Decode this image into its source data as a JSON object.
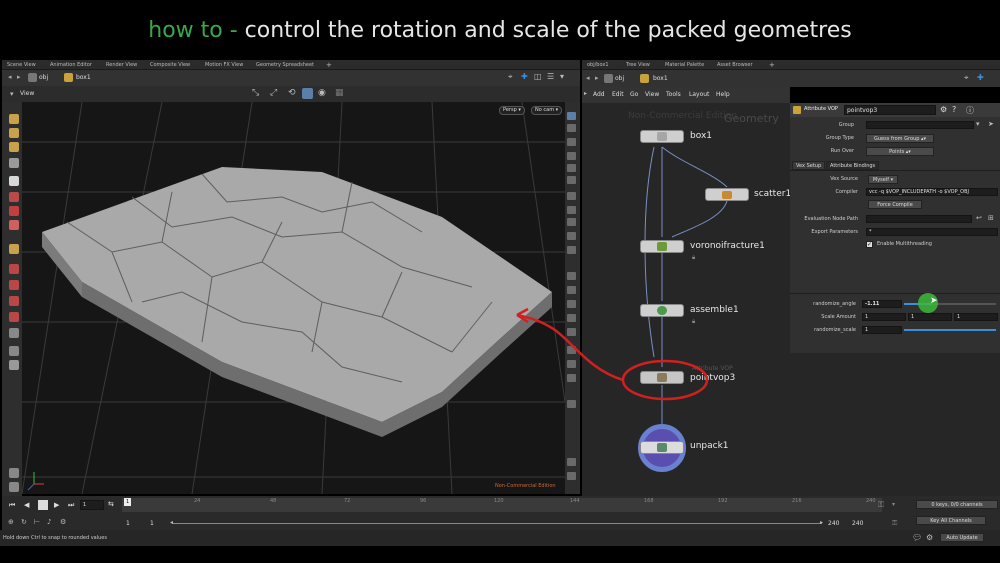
{
  "caption": {
    "highlight": "how to -",
    "rest": "control the rotation and scale of the packed geometres"
  },
  "left_tabs": [
    "Scene View",
    "Animation Editor",
    "Render View",
    "Composite View",
    "Motion FX View",
    "Geometry Spreadsheet",
    "+"
  ],
  "left_path": {
    "context": "obj",
    "node": "box1"
  },
  "viewport": {
    "name": "View",
    "camera": "Persp",
    "cam_dropdown": "No cam",
    "watermark": "Non-Commercial Edition"
  },
  "right_tabs": [
    "obj/box1",
    "Tree View",
    "Material Palette",
    "Asset Browser",
    "+"
  ],
  "right_path": {
    "context": "obj",
    "node": "box1"
  },
  "net_menu": [
    "Add",
    "Edit",
    "Go",
    "View",
    "Tools",
    "Layout",
    "Help"
  ],
  "network": {
    "watermark": "Non-Commercial Edition",
    "context_label": "Geometry",
    "nodes": [
      {
        "name": "box1",
        "flag": ""
      },
      {
        "name": "scatter1",
        "flag": ""
      },
      {
        "name": "voronoifracture1",
        "flag": ""
      },
      {
        "name": "assemble1",
        "flag": ""
      },
      {
        "name": "pointvop3",
        "type_label": "Attribute VOP"
      },
      {
        "name": "unpack1",
        "flag": ""
      }
    ]
  },
  "parms": {
    "node_type": "Attribute VOP",
    "node_name": "pointvop3",
    "group_label": "Group",
    "group_value": "",
    "group_type_label": "Group Type",
    "group_type_value": "Guess from Group",
    "run_over_label": "Run Over",
    "run_over_value": "Points",
    "tabs": [
      "Vex Setup",
      "Attribute Bindings"
    ],
    "vex_source_label": "Vex Source",
    "vex_source_value": "Myself",
    "compiler_label": "Compiler",
    "compiler_value": "vcc -q $VOP_INCLUDEPATH -o $VOP_OBJ",
    "force_compile": "Force Compile",
    "eval_path_label": "Evaluation Node Path",
    "eval_path_value": "",
    "export_label": "Export Parameters",
    "export_value": "*",
    "multithread_label": "Enable Multithreading",
    "multithread_checked": true,
    "randomize_angle_label": "randomize_angle",
    "randomize_angle_value": "-1.11",
    "randomize_angle_level": 0.3,
    "scale_amount_label": "Scale Amount",
    "scale_amount_values": [
      "1",
      "1",
      "1"
    ],
    "randomize_scale_label": "randomize_scale",
    "randomize_scale_value": "1",
    "randomize_scale_level": 1.0
  },
  "timeline": {
    "current_frame": "1",
    "frame_field": "1",
    "ticks": [
      "1",
      "24",
      "48",
      "72",
      "96",
      "120",
      "144",
      "168",
      "192",
      "216",
      "240"
    ],
    "range_start": "1",
    "range_start2": "1",
    "range_end": "240",
    "range_end2": "240",
    "keys_info": "0 keys, 0/0 channels",
    "key_all": "Key All Channels"
  },
  "status": {
    "hint": "Hold down Ctrl to snap to rounded values",
    "auto_update": "Auto Update"
  },
  "colors": {
    "caption_green": "#3aa84a",
    "annotation_red": "#d0201f",
    "wire": "#7a8fc8",
    "cursor_green": "#3cb83c"
  }
}
